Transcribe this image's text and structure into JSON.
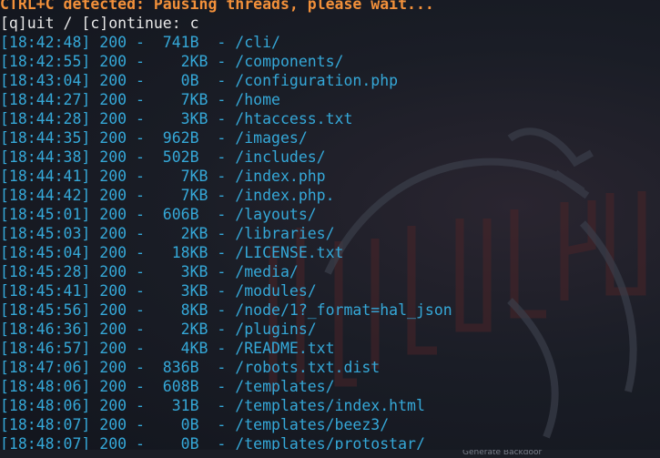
{
  "terminal": {
    "warning": "CTRL+C detected: Pausing threads, please wait...",
    "prompt": "[q]uit / [c]ontinue: c",
    "entries": [
      "[18:42:48] 200 -  741B  - /cli/",
      "[18:42:55] 200 -    2KB - /components/",
      "[18:43:04] 200 -    0B  - /configuration.php",
      "[18:44:27] 200 -    7KB - /home",
      "[18:44:28] 200 -    3KB - /htaccess.txt",
      "[18:44:35] 200 -  962B  - /images/",
      "[18:44:38] 200 -  502B  - /includes/",
      "[18:44:41] 200 -    7KB - /index.php",
      "[18:44:42] 200 -    7KB - /index.php.",
      "[18:45:01] 200 -  606B  - /layouts/",
      "[18:45:03] 200 -    2KB - /libraries/",
      "[18:45:04] 200 -   18KB - /LICENSE.txt",
      "[18:45:28] 200 -    3KB - /media/",
      "[18:45:41] 200 -    3KB - /modules/",
      "[18:45:56] 200 -    8KB - /node/1?_format=hal_json",
      "[18:46:36] 200 -    2KB - /plugins/",
      "[18:46:57] 200 -    4KB - /README.txt",
      "[18:47:06] 200 -  836B  - /robots.txt.dist",
      "[18:48:06] 200 -  608B  - /templates/",
      "[18:48:06] 200 -   31B  - /templates/index.html",
      "[18:48:07] 200 -    0B  - /templates/beez3/",
      "[18:48:07] 200 -    0B  - /templates/protostar/"
    ]
  },
  "taskbar": {
    "label": "Generate Backdoor"
  },
  "colors": {
    "warning": "#f2903a",
    "prompt": "#e8e8e8",
    "entry": "#35a8d8",
    "background": "#141821"
  }
}
